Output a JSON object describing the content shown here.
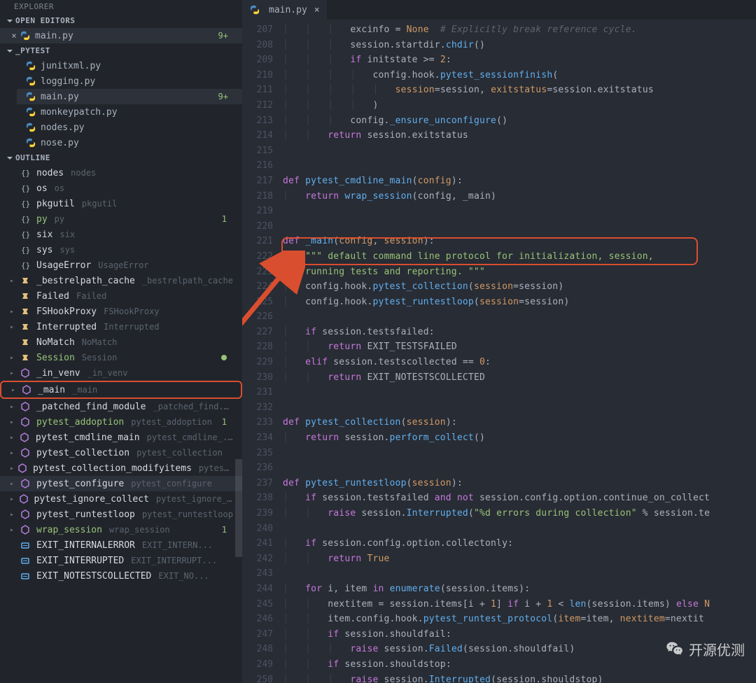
{
  "sidebar": {
    "explorer_title": "EXPLORER",
    "open_editors_title": "OPEN EDITORS",
    "open_editors": [
      {
        "name": "main.py",
        "badge": "9+"
      }
    ],
    "project_section_title": "_PYTEST",
    "files": [
      {
        "name": "junitxml.py",
        "active": false,
        "badge": ""
      },
      {
        "name": "logging.py",
        "active": false,
        "badge": ""
      },
      {
        "name": "main.py",
        "active": true,
        "badge": "9+"
      },
      {
        "name": "monkeypatch.py",
        "active": false,
        "badge": ""
      },
      {
        "name": "nodes.py",
        "active": false,
        "badge": ""
      },
      {
        "name": "nose.py",
        "active": false,
        "badge": ""
      }
    ],
    "outline_title": "OUTLINE",
    "outline": [
      {
        "kind": "ns",
        "label": "nodes",
        "detail": "nodes",
        "expand": false
      },
      {
        "kind": "ns",
        "label": "os",
        "detail": "os",
        "expand": false
      },
      {
        "kind": "ns",
        "label": "pkgutil",
        "detail": "pkgutil",
        "expand": false
      },
      {
        "kind": "ns",
        "label": "py",
        "detail": "py",
        "expand": false,
        "green": true,
        "badge1": true
      },
      {
        "kind": "ns",
        "label": "six",
        "detail": "six",
        "expand": false
      },
      {
        "kind": "ns",
        "label": "sys",
        "detail": "sys",
        "expand": false
      },
      {
        "kind": "ns",
        "label": "UsageError",
        "detail": "UsageError",
        "expand": false
      },
      {
        "kind": "class",
        "label": "_bestrelpath_cache",
        "detail": "_bestrelpath_cache",
        "expand": true
      },
      {
        "kind": "class",
        "label": "Failed",
        "detail": "Failed",
        "expand": false
      },
      {
        "kind": "class",
        "label": "FSHookProxy",
        "detail": "FSHookProxy",
        "expand": true
      },
      {
        "kind": "class",
        "label": "Interrupted",
        "detail": "Interrupted",
        "expand": true
      },
      {
        "kind": "class",
        "label": "NoMatch",
        "detail": "NoMatch",
        "expand": false
      },
      {
        "kind": "class",
        "label": "Session",
        "detail": "Session",
        "expand": true,
        "green": true,
        "dot": true
      },
      {
        "kind": "func",
        "label": "_in_venv",
        "detail": "_in_venv",
        "expand": true
      },
      {
        "kind": "func",
        "label": "_main",
        "detail": "_main",
        "expand": true,
        "highlighted": true
      },
      {
        "kind": "func",
        "label": "_patched_find_module",
        "detail": "_patched_find...",
        "expand": true
      },
      {
        "kind": "func",
        "label": "pytest_addoption",
        "detail": "pytest_addoption",
        "expand": true,
        "green": true,
        "badge1": true
      },
      {
        "kind": "func",
        "label": "pytest_cmdline_main",
        "detail": "pytest_cmdline_...",
        "expand": true
      },
      {
        "kind": "func",
        "label": "pytest_collection",
        "detail": "pytest_collection",
        "expand": true
      },
      {
        "kind": "func",
        "label": "pytest_collection_modifyitems",
        "detail": "pytest_...",
        "expand": true
      },
      {
        "kind": "func",
        "label": "pytest_configure",
        "detail": "pytest_configure",
        "expand": true,
        "active": true
      },
      {
        "kind": "func",
        "label": "pytest_ignore_collect",
        "detail": "pytest_ignore_c...",
        "expand": true
      },
      {
        "kind": "func",
        "label": "pytest_runtestloop",
        "detail": "pytest_runtestloop",
        "expand": true
      },
      {
        "kind": "func",
        "label": "wrap_session",
        "detail": "wrap_session",
        "expand": true,
        "green": true,
        "badge1": true
      },
      {
        "kind": "const",
        "label": "EXIT_INTERNALERROR",
        "detail": "EXIT_INTERN...",
        "expand": false
      },
      {
        "kind": "const",
        "label": "EXIT_INTERRUPTED",
        "detail": "EXIT_INTERRUPT...",
        "expand": false
      },
      {
        "kind": "const",
        "label": "EXIT_NOTESTSCOLLECTED",
        "detail": "EXIT_NO...",
        "expand": false
      }
    ]
  },
  "editor": {
    "tab_label": "main.py",
    "first_line_no": 207,
    "lines": [
      "            excinfo = <cnst>None</cnst>  <cmt># Explicitly break reference cycle.</cmt>",
      "            session.startdir.<fn>chdir</fn>()",
      "            <kw>if</kw> initstate >= <num>2</num>:",
      "                config.hook.<fn>pytest_sessionfinish</fn>(",
      "                    <prm>session</prm>=session, <prm>exitstatus</prm>=session.exitstatus",
      "                )",
      "            config.<fn>_ensure_unconfigure</fn>()",
      "        <kw>return</kw> session.exitstatus",
      "",
      "",
      "<kw>def</kw> <fn>pytest_cmdline_main</fn>(<prm>config</prm>):",
      "    <kw>return</kw> <fn>wrap_session</fn>(config, _main)",
      "",
      "",
      "<kw>def</kw> <fn>_main</fn>(<prm>config</prm>, <prm>session</prm>):",
      "    <str>\"\"\" default command line protocol for initialization, session,</str>",
      "<str>    running tests and reporting. \"\"\"</str>",
      "    config.hook.<fn>pytest_collection</fn>(<prm>session</prm>=session)",
      "    config.hook.<fn>pytest_runtestloop</fn>(<prm>session</prm>=session)",
      "",
      "    <kw>if</kw> session.testsfailed:",
      "        <kw>return</kw> EXIT_TESTSFAILED",
      "    <kw>elif</kw> session.testscollected == <num>0</num>:",
      "        <kw>return</kw> EXIT_NOTESTSCOLLECTED",
      "",
      "",
      "<kw>def</kw> <fn>pytest_collection</fn>(<prm>session</prm>):",
      "    <kw>return</kw> session.<fn>perform_collect</fn>()",
      "",
      "",
      "<kw>def</kw> <fn>pytest_runtestloop</fn>(<prm>session</prm>):",
      "    <kw>if</kw> session.testsfailed <kw>and</kw> <kw>not</kw> session.config.option.continue_on_collect",
      "        <kw>raise</kw> session.<fn>Interrupted</fn>(<str>\"%d errors during collection\"</str> % session.te",
      "",
      "    <kw>if</kw> session.config.option.collectonly:",
      "        <kw>return</kw> <cnst>True</cnst>",
      "",
      "    <kw>for</kw> i, item <kw>in</kw> <fn>enumerate</fn>(session.items):",
      "        nextitem = session.items[i + <num>1</num>] <kw>if</kw> i + <num>1</num> < <fn>len</fn>(session.items) <kw>else</kw> <cnst>N</cnst>",
      "        item.config.hook.<fn>pytest_runtest_protocol</fn>(<prm>item</prm>=item, <prm>nextitem</prm>=nextit",
      "        <kw>if</kw> session.shouldfail:",
      "            <kw>raise</kw> session.<fn>Failed</fn>(session.shouldfail)",
      "        <kw>if</kw> session.shouldstop:",
      "            <kw>raise</kw> session.<fn>Interrupted</fn>(session.shouldstop)"
    ]
  },
  "watermark_text": "开源优测"
}
